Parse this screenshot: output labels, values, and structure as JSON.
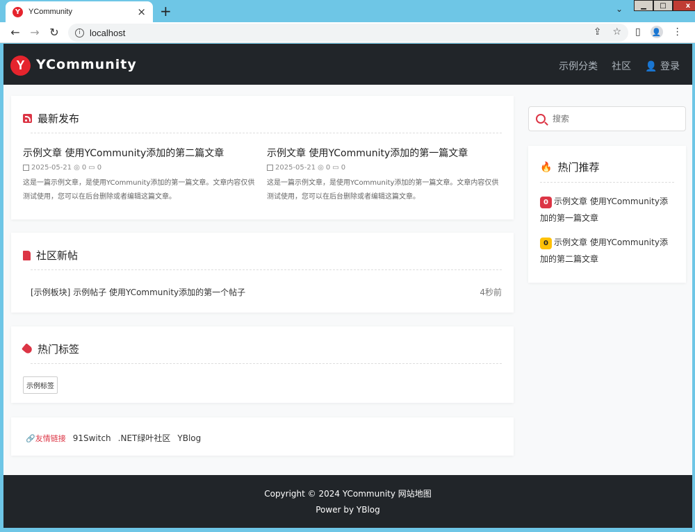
{
  "browser": {
    "tab_title": "YCommunity",
    "tab_favicon": "Y",
    "url": "localhost"
  },
  "header": {
    "logo_letter": "Y",
    "brand": "YCommunity",
    "nav": [
      "示例分类",
      "社区",
      "登录"
    ]
  },
  "latest": {
    "title": "最新发布",
    "articles": [
      {
        "title": "示例文章 使用YCommunity添加的第二篇文章",
        "date": "2025-05-21",
        "views": "0",
        "comments": "0",
        "desc": "这是一篇示例文章，是使用YCommunity添加的第一篇文章。文章内容仅供测试使用，您可以在后台删除或者编辑这篇文章。"
      },
      {
        "title": "示例文章 使用YCommunity添加的第一篇文章",
        "date": "2025-05-21",
        "views": "0",
        "comments": "0",
        "desc": "这是一篇示例文章，是使用YCommunity添加的第一篇文章。文章内容仅供测试使用，您可以在后台删除或者编辑这篇文章。"
      }
    ]
  },
  "community": {
    "title": "社区新帖",
    "posts": [
      {
        "board": "[示例板块]",
        "title": "示例帖子 使用YCommunity添加的第一个帖子",
        "time": "4秒前"
      }
    ]
  },
  "tags": {
    "title": "热门标签",
    "items": [
      "示例标签"
    ]
  },
  "links": {
    "label": "友情链接",
    "items": [
      "91Switch",
      ".NET绿叶社区",
      "YBlog"
    ]
  },
  "search": {
    "placeholder": "搜索"
  },
  "hot": {
    "title": "热门推荐",
    "items": [
      {
        "rank": "0",
        "title": "示例文章 使用YCommunity添加的第一篇文章"
      },
      {
        "rank": "0",
        "title": "示例文章 使用YCommunity添加的第二篇文章"
      }
    ]
  },
  "footer": {
    "copyright": "Copyright © 2024 YCommunity 网站地图",
    "powered": "Power by YBlog"
  },
  "colors": {
    "accent": "#dc3545",
    "header_bg": "#212529",
    "rank_second": "#ffc107"
  }
}
